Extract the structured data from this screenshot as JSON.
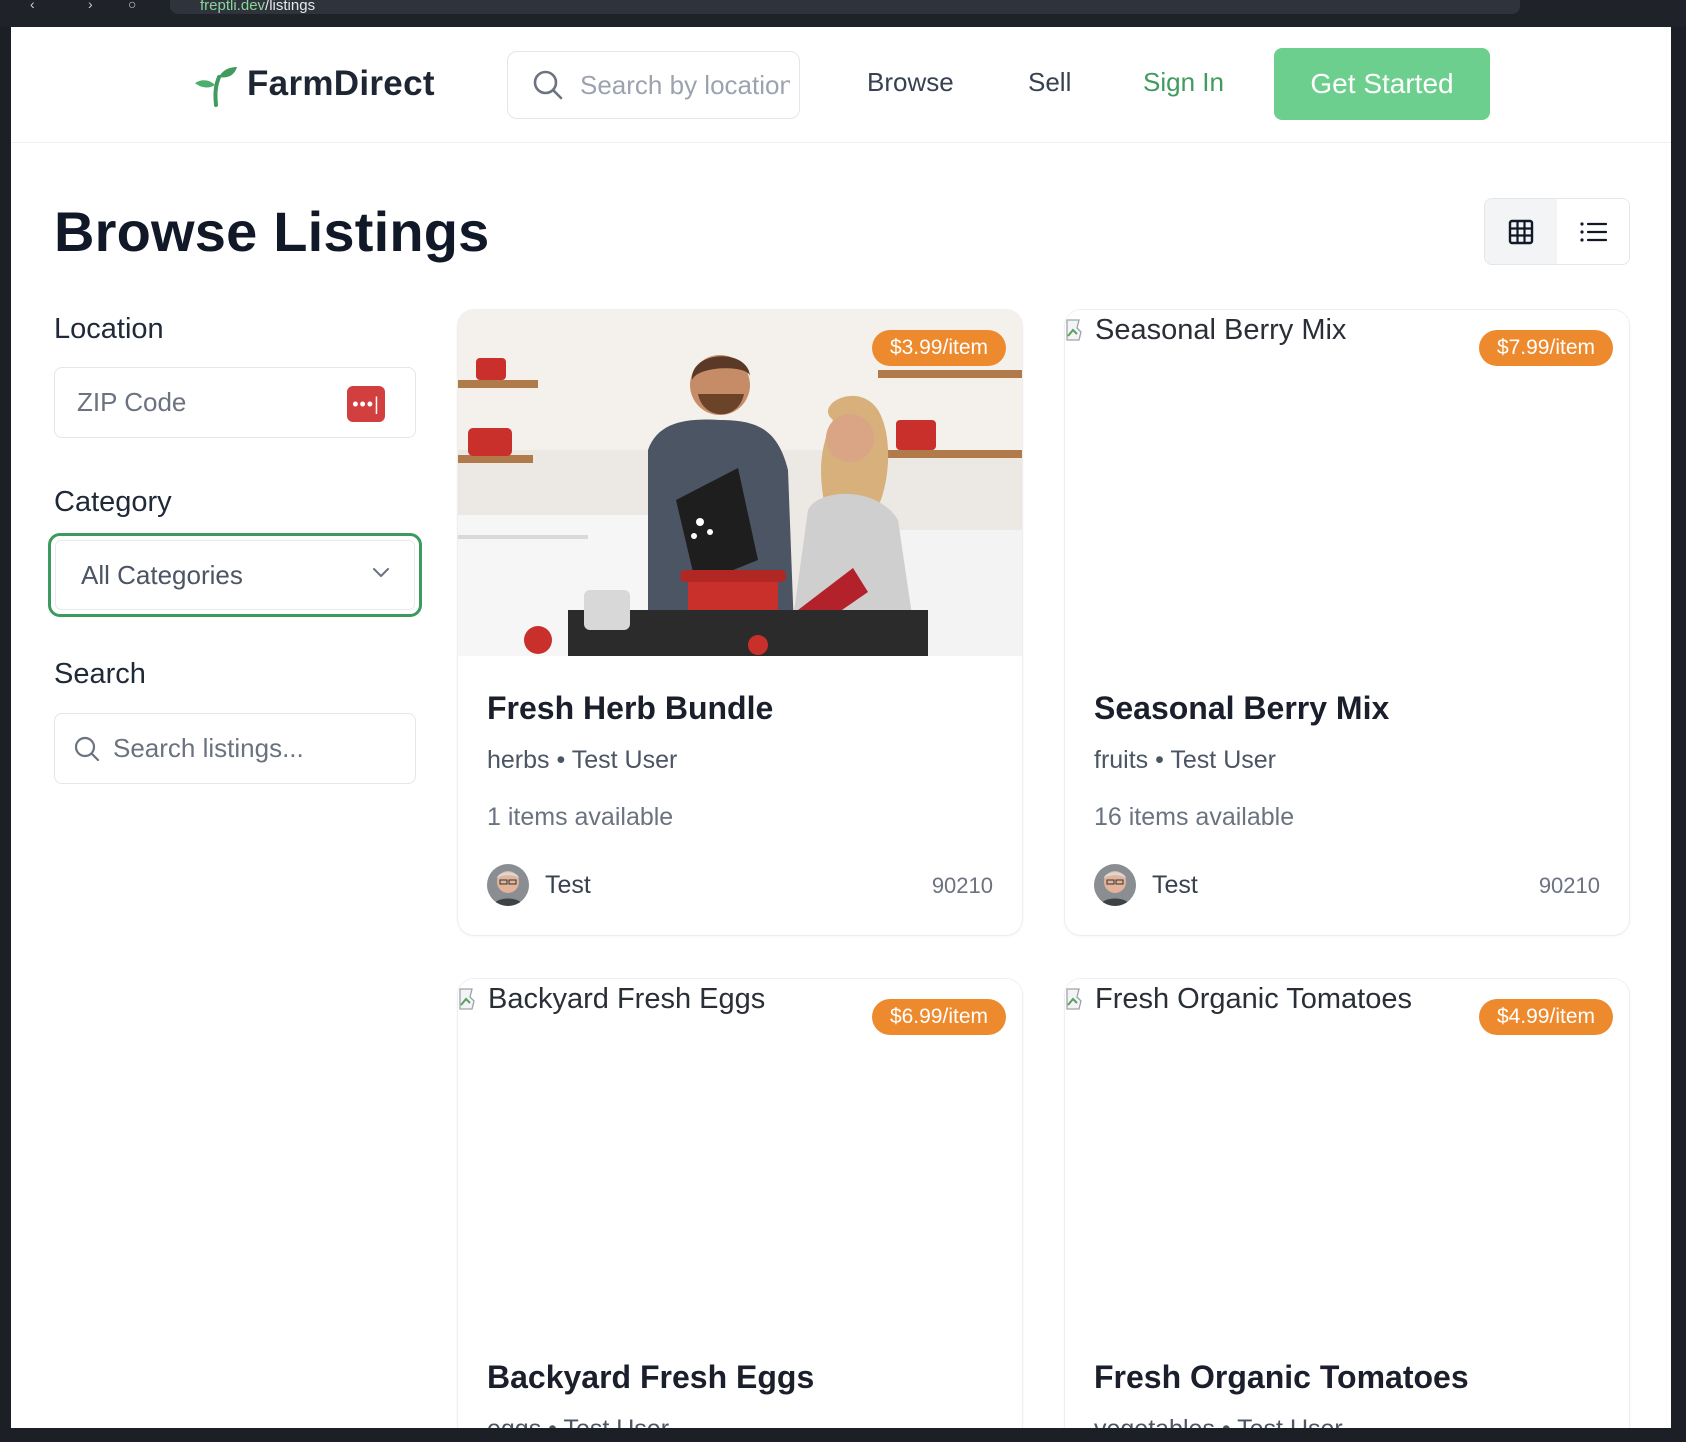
{
  "browser": {
    "url_host": "freptli.dev",
    "url_path": "/listings"
  },
  "header": {
    "brand": "FarmDirect",
    "search_placeholder": "Search by location",
    "nav": {
      "browse": "Browse",
      "sell": "Sell",
      "sign_in": "Sign In"
    },
    "cta": "Get Started"
  },
  "main": {
    "title": "Browse Listings",
    "view_modes": [
      "grid-icon",
      "list-icon"
    ],
    "active_view": "grid"
  },
  "filters": {
    "location_label": "Location",
    "zip_placeholder": "ZIP Code",
    "category_label": "Category",
    "category_value": "All Categories",
    "search_label": "Search",
    "search_placeholder": "Search listings..."
  },
  "listings": [
    {
      "title": "Fresh Herb Bundle",
      "price": "$3.99/item",
      "category": "herbs",
      "seller_name": "Test User",
      "meta_sep": "•",
      "available": "1 items available",
      "seller_short": "Test",
      "zip": "90210",
      "image_alt": "",
      "image_loaded": true
    },
    {
      "title": "Seasonal Berry Mix",
      "price": "$7.99/item",
      "category": "fruits",
      "seller_name": "Test User",
      "meta_sep": "•",
      "available": "16 items available",
      "seller_short": "Test",
      "zip": "90210",
      "image_alt": "Seasonal Berry Mix",
      "image_loaded": false
    },
    {
      "title": "Backyard Fresh Eggs",
      "price": "$6.99/item",
      "category": "eggs",
      "seller_name": "Test User",
      "meta_sep": "•",
      "image_alt": "Backyard Fresh Eggs",
      "image_loaded": false
    },
    {
      "title": "Fresh Organic Tomatoes",
      "price": "$4.99/item",
      "category": "vegetables",
      "seller_name": "Test User",
      "meta_sep": "•",
      "image_alt": "Fresh Organic Tomatoes",
      "image_loaded": false
    }
  ],
  "colors": {
    "brand_green": "#3f9b5e",
    "cta_green": "#6dcf8d",
    "price_orange": "#ee8a2e",
    "focus_ring": "#3c9a5f"
  }
}
